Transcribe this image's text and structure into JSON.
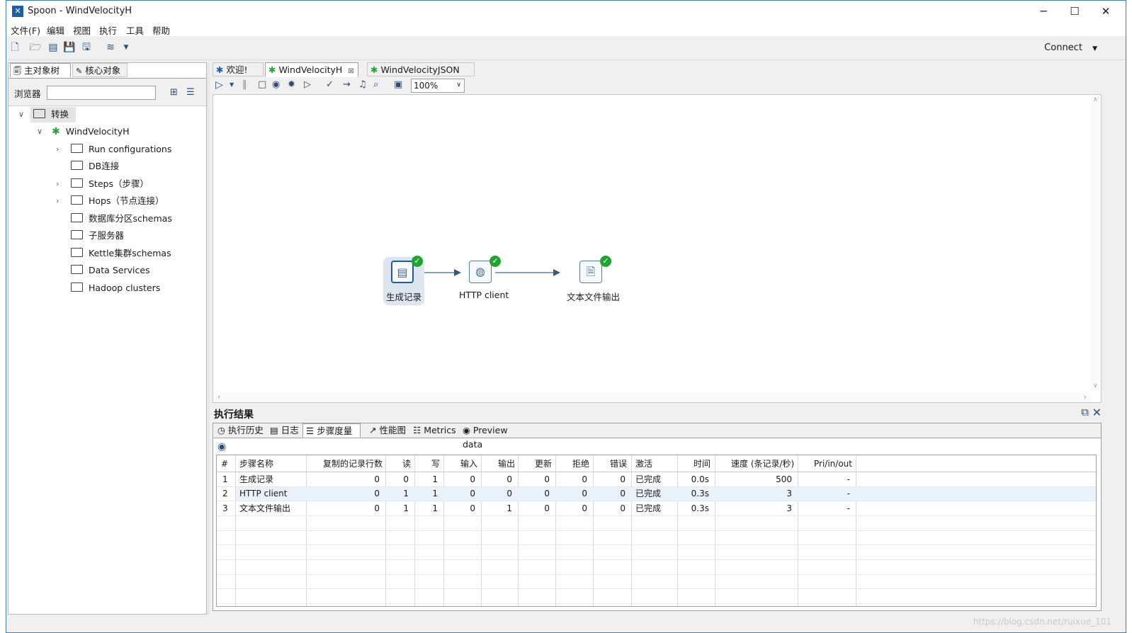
{
  "window": {
    "title": "Spoon - WindVelocityH"
  },
  "menu": [
    "文件(F)",
    "编辑",
    "视图",
    "执行",
    "工具",
    "帮助"
  ],
  "toolbar": {
    "connect_label": "Connect"
  },
  "left_panel": {
    "tabs": [
      "主对象树",
      "核心对象"
    ],
    "browser_label": "浏览器",
    "browser_value": "",
    "tree": {
      "root": "转换",
      "transformation": "WindVelocityH",
      "items": [
        "Run configurations",
        "DB连接",
        "Steps（步骤）",
        "Hops（节点连接）",
        "数据库分区schemas",
        "子服务器",
        "Kettle集群schemas",
        "Data Services",
        "Hadoop clusters"
      ]
    }
  },
  "editor": {
    "tabs": [
      "欢迎!",
      "WindVelocityH",
      "WindVelocityJSON"
    ],
    "zoom": "100%",
    "steps": [
      "生成记录",
      "HTTP client",
      "文本文件输出"
    ]
  },
  "results": {
    "title": "执行结果",
    "tabs": [
      "执行历史",
      "日志",
      "步骤度量",
      "性能图",
      "Metrics",
      "Preview data"
    ],
    "columns": [
      "#",
      "步骤名称",
      "复制的记录行数",
      "读",
      "写",
      "输入",
      "输出",
      "更新",
      "拒绝",
      "错误",
      "激活",
      "时间",
      "速度 (条记录/秒)",
      "Pri/in/out"
    ],
    "rows": [
      [
        "1",
        "生成记录",
        "0",
        "0",
        "1",
        "0",
        "0",
        "0",
        "0",
        "0",
        "已完成",
        "0.0s",
        "500",
        "-"
      ],
      [
        "2",
        "HTTP client",
        "0",
        "1",
        "1",
        "0",
        "0",
        "0",
        "0",
        "0",
        "已完成",
        "0.3s",
        "3",
        "-"
      ],
      [
        "3",
        "文本文件输出",
        "0",
        "1",
        "1",
        "0",
        "1",
        "0",
        "0",
        "0",
        "已完成",
        "0.3s",
        "3",
        "-"
      ]
    ]
  },
  "watermark": "https://blog.csdn.net/ruixue_101"
}
